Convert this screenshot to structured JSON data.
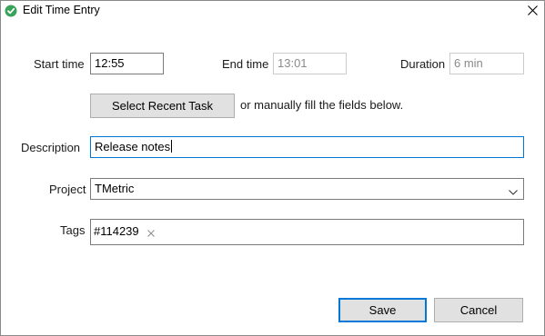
{
  "window": {
    "title": "Edit Time Entry",
    "icon": "tmetric-logo-icon",
    "close_icon": "close-icon"
  },
  "times": {
    "start_label": "Start time",
    "start_value": "12:55",
    "end_label": "End time",
    "end_value": "13:01",
    "duration_label": "Duration",
    "duration_value": "6 min"
  },
  "recent": {
    "button_label": "Select Recent Task",
    "hint": "or manually fill the fields below."
  },
  "description": {
    "label": "Description",
    "value": "Release notes"
  },
  "project": {
    "label": "Project",
    "value": "TMetric",
    "arrow_icon": "chevron-down-icon"
  },
  "tags": {
    "label": "Tags",
    "items": [
      "#114239"
    ],
    "remove_icon": "close-icon"
  },
  "actions": {
    "save_label": "Save",
    "cancel_label": "Cancel"
  },
  "colors": {
    "focus": "#0078d7",
    "button_bg": "#e1e1e1",
    "logo": "#3aa35a"
  }
}
